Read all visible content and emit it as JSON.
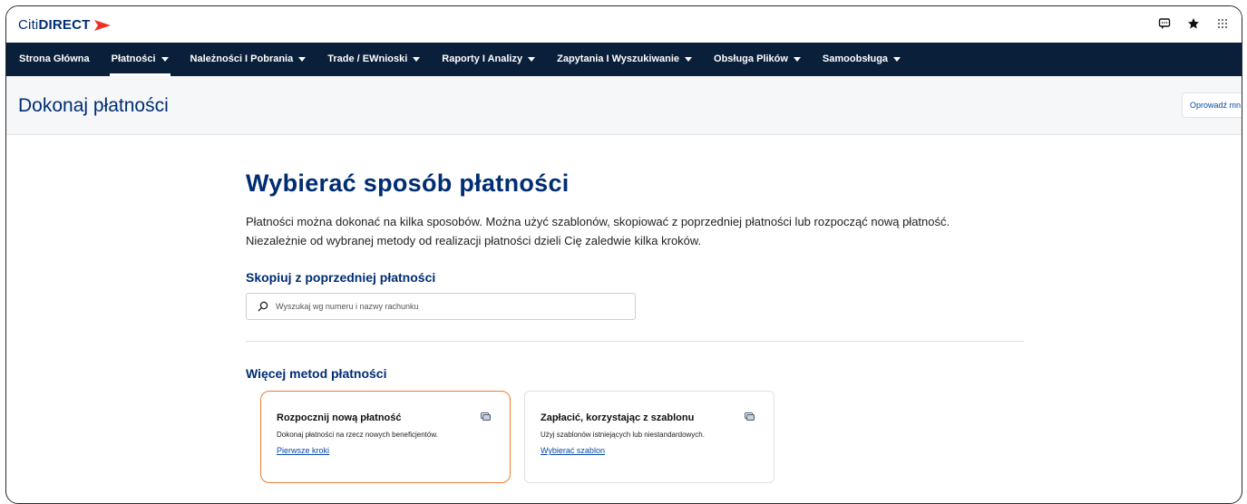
{
  "brand": {
    "citi": "Citi",
    "direct": "DIRECT",
    "accent": "#ee3124",
    "navy": "#002d72"
  },
  "top_icons": [
    "chat-icon",
    "star-icon",
    "apps-grid-icon"
  ],
  "nav": {
    "items": [
      {
        "label": "Strona Główna",
        "dropdown": false,
        "active": false
      },
      {
        "label": "Płatności",
        "dropdown": true,
        "active": true
      },
      {
        "label": "Należności I Pobrania",
        "dropdown": true,
        "active": false
      },
      {
        "label": "Trade / EWnioski",
        "dropdown": true,
        "active": false
      },
      {
        "label": "Raporty I Analizy",
        "dropdown": true,
        "active": false
      },
      {
        "label": "Zapytania I Wyszukiwanie",
        "dropdown": true,
        "active": false
      },
      {
        "label": "Obsługa Plików",
        "dropdown": true,
        "active": false
      },
      {
        "label": "Samoobsługa",
        "dropdown": true,
        "active": false
      }
    ]
  },
  "page": {
    "title": "Dokonaj płatności",
    "guide_button": "Oprowadź mn"
  },
  "main": {
    "heading": "Wybierać sposób płatności",
    "intro_line1": "Płatności można dokonać na kilka sposobów. Można użyć szablonów, skopiować z poprzedniej płatności lub rozpocząć nową płatność.",
    "intro_line2": "Niezależnie od wybranej metody od realizacji płatności dzieli Cię zaledwie kilka kroków.",
    "copy_heading": "Skopiuj z poprzedniej płatności",
    "search_placeholder": "Wyszukaj wg numeru i nazwy rachunku",
    "search_value": "",
    "more_heading": "Więcej metod płatności",
    "cards": [
      {
        "title": "Rozpocznij nową płatność",
        "desc": "Dokonaj płatności na rzecz nowych beneficjentów.",
        "link": "Pierwsze kroki",
        "highlighted": true
      },
      {
        "title": "Zapłacić, korzystając z szablonu",
        "desc": "Użyj szablonów istniejących lub niestandardowych.",
        "link": "Wybierać szablon",
        "highlighted": false
      }
    ]
  }
}
